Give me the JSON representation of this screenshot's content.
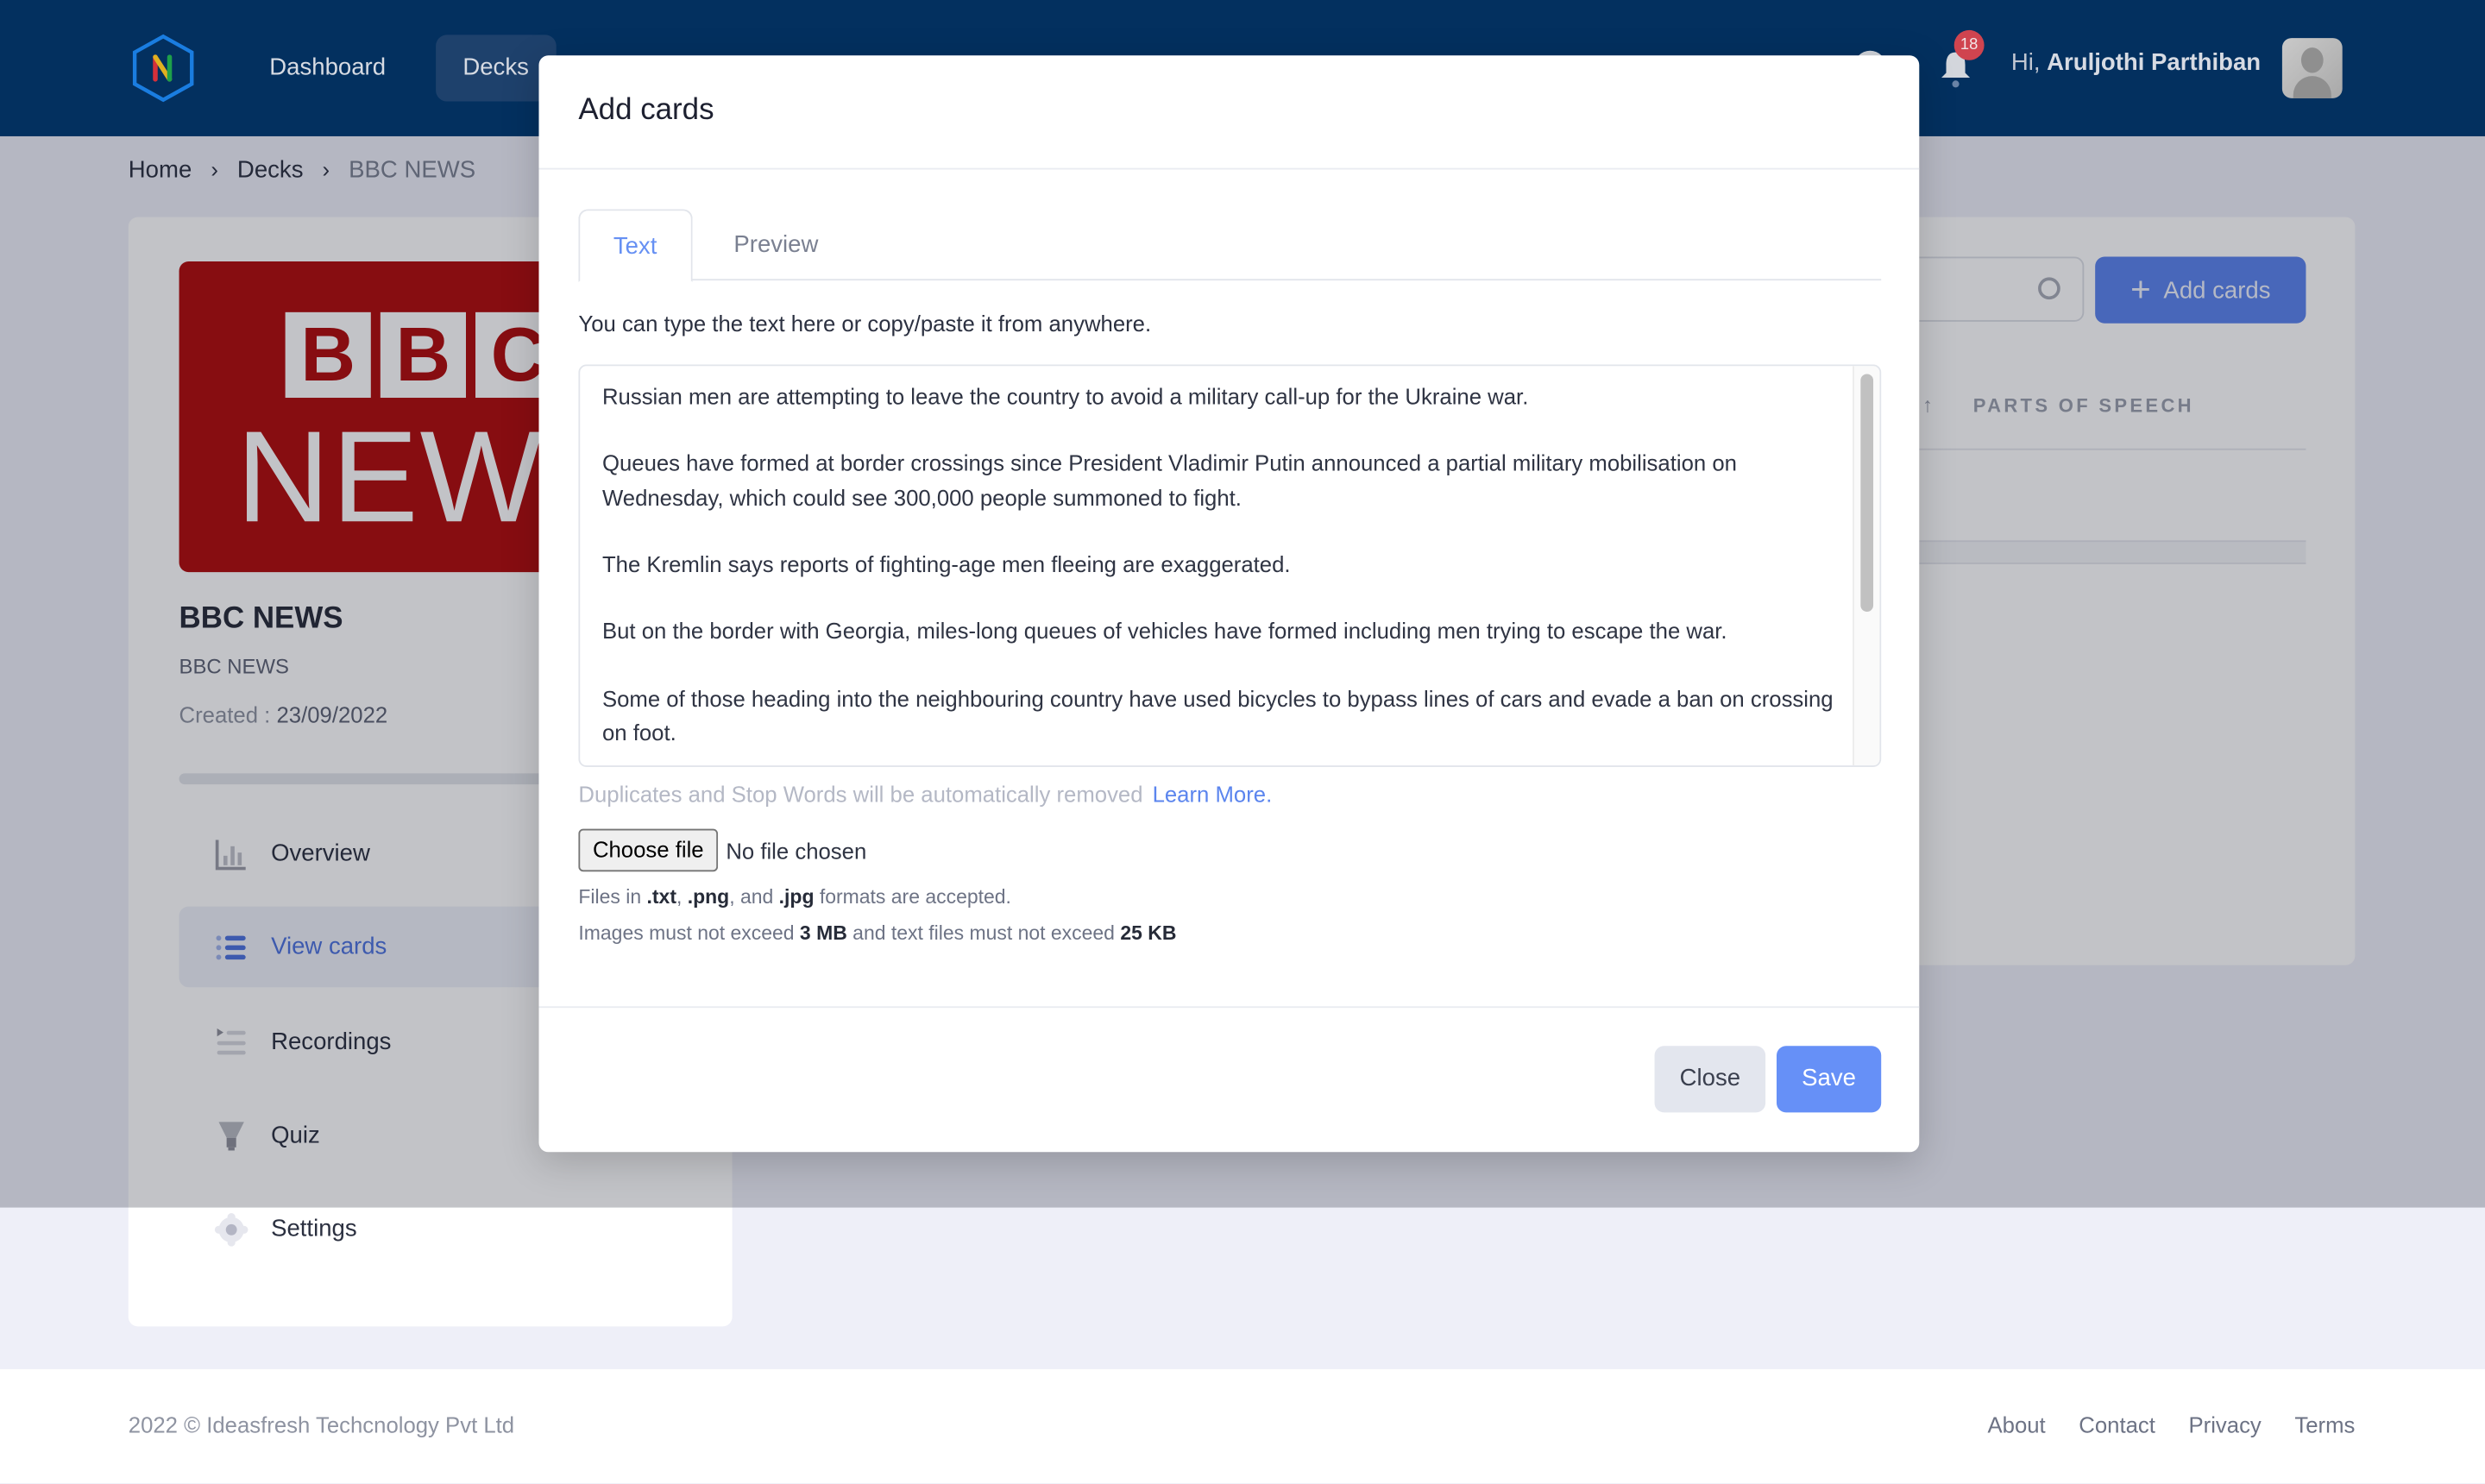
{
  "header": {
    "nav": [
      {
        "label": "Dashboard",
        "active": false
      },
      {
        "label": "Decks",
        "active": true
      }
    ],
    "notifications_count": "18",
    "greeting_prefix": "Hi, ",
    "user_name": "Aruljothi Parthiban",
    "colors": {
      "background": "#03305f",
      "badge": "#d0444f"
    }
  },
  "breadcrumb": [
    {
      "label": "Home"
    },
    {
      "label": "Decks"
    },
    {
      "label": "BBC NEWS",
      "current": true
    }
  ],
  "deck": {
    "image_text_top": [
      "B",
      "B",
      "C"
    ],
    "image_text_bottom": "NEWS",
    "title": "BBC NEWS",
    "subtitle": "BBC NEWS",
    "created_label": "Created : ",
    "created_value": "23/09/2022"
  },
  "sidebar": {
    "items": [
      {
        "label": "Overview",
        "icon": "bar-chart-icon",
        "active": false
      },
      {
        "label": "View cards",
        "icon": "list-icon",
        "active": true
      },
      {
        "label": "Recordings",
        "icon": "playlist-icon",
        "active": false
      },
      {
        "label": "Quiz",
        "icon": "lightbulb-icon",
        "active": false
      },
      {
        "label": "Settings",
        "icon": "gear-icon",
        "active": false
      }
    ]
  },
  "main": {
    "add_cards_button": "Add cards",
    "table_headers": [
      "PARTS OF SPEECH"
    ]
  },
  "modal": {
    "title": "Add cards",
    "tabs": [
      {
        "label": "Text",
        "active": true
      },
      {
        "label": "Preview",
        "active": false
      }
    ],
    "helper_text": "You can type the text here or copy/paste it from anywhere.",
    "textarea_value": "Russian men are attempting to leave the country to avoid a military call-up for the Ukraine war.\n\nQueues have formed at border crossings since President Vladimir Putin announced a partial military mobilisation on Wednesday, which could see 300,000 people summoned to fight.\n\nThe Kremlin says reports of fighting-age men fleeing are exaggerated.\n\nBut on the border with Georgia, miles-long queues of vehicles have formed including men trying to escape the war.\n\nSome of those heading into the neighbouring country have used bicycles to bypass lines of cars and evade a ban on crossing on foot.",
    "duplicates_note": "Duplicates and Stop Words will be automatically removed",
    "learn_more": "Learn More.",
    "choose_file_label": "Choose file",
    "no_file_label": "No file chosen",
    "files_note": {
      "prefix": "Files in ",
      "fmt1": ".txt",
      "sep1": ", ",
      "fmt2": ".png",
      "sep2": ", and ",
      "fmt3": ".jpg",
      "suffix": " formats are accepted."
    },
    "size_note": {
      "prefix": "Images must not exceed ",
      "image_limit": "3 MB",
      "middle": " and text files must not exceed ",
      "text_limit": "25 KB"
    },
    "close_label": "Close",
    "save_label": "Save",
    "colors": {
      "accent": "#6690f7",
      "close_bg": "#e3e6ee"
    }
  },
  "footer": {
    "copyright": "2022 © Ideasfresh Techcnology Pvt Ltd",
    "links": [
      "About",
      "Contact",
      "Privacy",
      "Terms"
    ]
  }
}
